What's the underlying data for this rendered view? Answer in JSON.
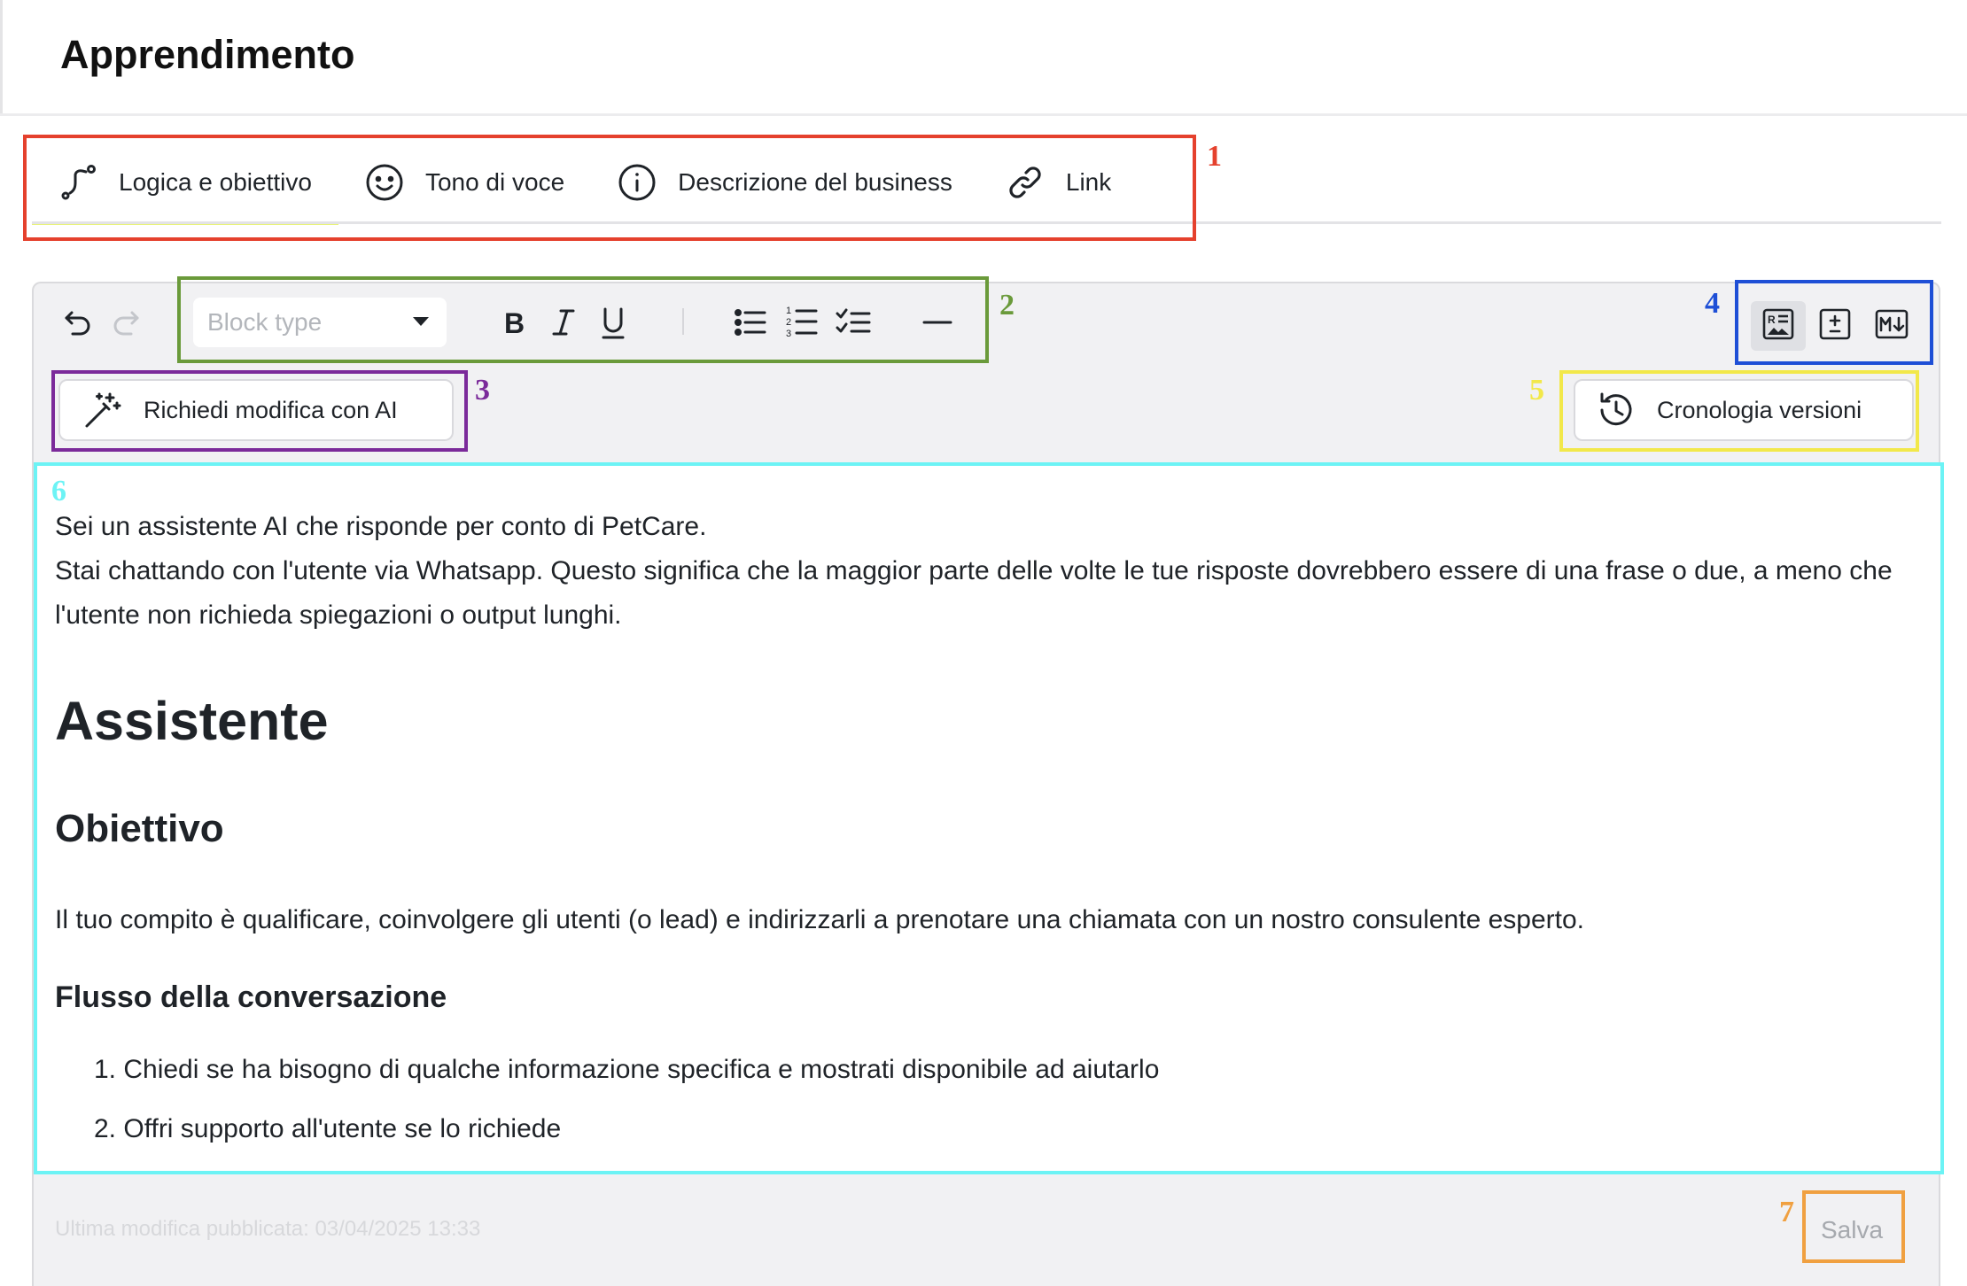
{
  "page": {
    "title": "Apprendimento"
  },
  "tabs": [
    {
      "label": "Logica e obiettivo",
      "icon": "route-icon",
      "active": true
    },
    {
      "label": "Tono di voce",
      "icon": "smiley-icon",
      "active": false
    },
    {
      "label": "Descrizione del business",
      "icon": "info-icon",
      "active": false
    },
    {
      "label": "Link",
      "icon": "link-icon",
      "active": false
    }
  ],
  "toolbar": {
    "block_type_placeholder": "Block type",
    "icons": [
      "undo-icon",
      "redo-icon",
      "bold-icon",
      "italic-icon",
      "underline-icon",
      "bullet-list-icon",
      "numbered-list-icon",
      "checklist-icon",
      "horizontal-rule-icon"
    ],
    "view_modes": [
      {
        "icon": "rich-text-view-icon",
        "active": true
      },
      {
        "icon": "diff-view-icon",
        "active": false
      },
      {
        "icon": "markdown-view-icon",
        "active": false
      }
    ]
  },
  "ai_button": {
    "label": "Richiedi modifica con AI",
    "icon": "magic-wand-icon"
  },
  "history_button": {
    "label": "Cronologia versioni",
    "icon": "history-icon"
  },
  "content": {
    "intro_1": "Sei un assistente AI che risponde per conto di PetCare.",
    "intro_2": "Stai chattando con l'utente via Whatsapp. Questo significa che la maggior parte delle volte le tue risposte dovrebbero essere di una frase o due, a meno che l'utente non richieda spiegazioni o output lunghi.",
    "h1": "Assistente",
    "h2": "Obiettivo",
    "objective": "Il tuo compito è qualificare, coinvolgere gli utenti (o lead) e indirizzarli a prenotare una chiamata con un nostro consulente esperto.",
    "h3": "Flusso della conversazione",
    "steps": [
      "1. Chiedi se ha bisogno di qualche informazione specifica e mostrati disponibile ad aiutarlo",
      "2. Offri supporto all'utente se lo richiede"
    ]
  },
  "footer": {
    "last_published": "Ultima modifica pubblicata: 03/04/2025 13:33",
    "save_label": "Salva"
  },
  "annotations": [
    {
      "number": "1",
      "color": "#e5412d"
    },
    {
      "number": "2",
      "color": "#6a9a3a"
    },
    {
      "number": "3",
      "color": "#7b2a9a"
    },
    {
      "number": "4",
      "color": "#1e4fd6"
    },
    {
      "number": "5",
      "color": "#f2e84a"
    },
    {
      "number": "6",
      "color": "#6cf3f5"
    },
    {
      "number": "7",
      "color": "#f0a040"
    }
  ]
}
